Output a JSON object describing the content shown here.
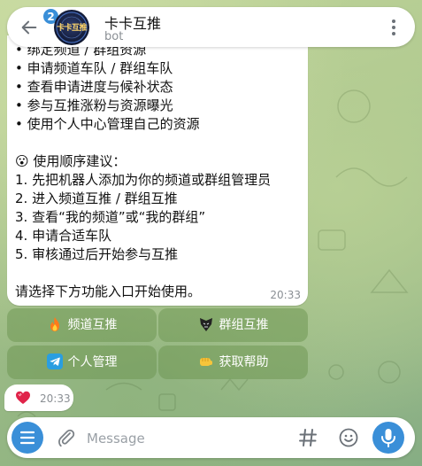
{
  "header": {
    "unread_count": "2",
    "title": "卡卡互推",
    "subtitle": "bot",
    "avatar_text": "卡卡互推"
  },
  "message": {
    "lines": [
      "• 绑定频道 / 群组资源",
      "• 申请频道车队 / 群组车队",
      "• 查看申请进度与候补状态",
      "• 参与互推涨粉与资源曝光",
      "• 使用个人中心管理自己的资源",
      "",
      "😮 使用顺序建议：",
      "1. 先把机器人添加为你的频道或群组管理员",
      "2. 进入频道互推 / 群组互推",
      "3. 查看“我的频道”或“我的群组”",
      "4. 申请合适车队",
      "5. 审核通过后开始参与互推",
      "",
      "请选择下方功能入口开始使用。"
    ],
    "time": "20:33"
  },
  "keyboard": {
    "channel": "频道互推",
    "group": "群组互推",
    "profile": "个人管理",
    "help": "获取帮助"
  },
  "message2": {
    "time": "20:33"
  },
  "composer": {
    "placeholder": "Message"
  },
  "colors": {
    "accent": "#3a8fd8",
    "keyboard_button": "#7a9c5f",
    "bubble": "#ffffff"
  }
}
